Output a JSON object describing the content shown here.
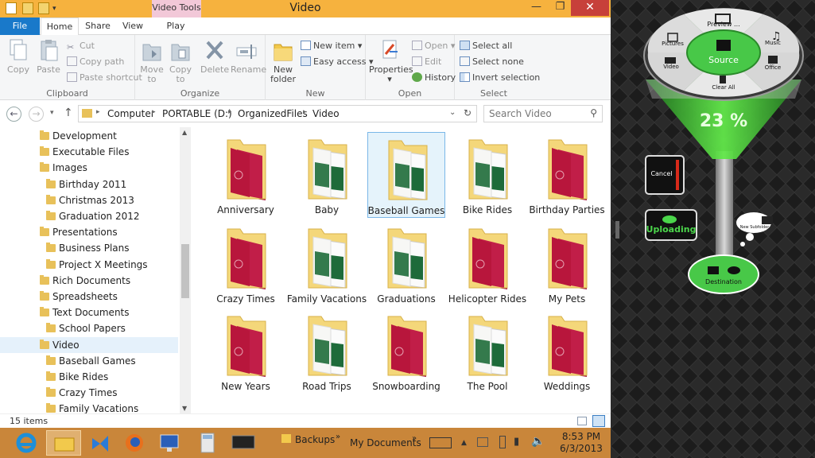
{
  "window": {
    "title": "Video",
    "context_tab": "Video Tools",
    "minimize_icon": "minimize-icon",
    "maximize_icon": "restore-icon",
    "close_icon": "close-icon"
  },
  "tabs": {
    "file": "File",
    "home": "Home",
    "share": "Share",
    "view": "View",
    "play": "Play"
  },
  "ribbon": {
    "clipboard": {
      "label": "Clipboard",
      "copy": "Copy",
      "paste": "Paste",
      "cut": "Cut",
      "copy_path": "Copy path",
      "paste_shortcut": "Paste shortcut"
    },
    "organize": {
      "label": "Organize",
      "move_to": "Move",
      "move_to_sub": "to",
      "copy_to": "Copy",
      "copy_to_sub": "to",
      "delete": "Delete",
      "rename": "Rename"
    },
    "new": {
      "label": "New",
      "new_folder": "New",
      "new_folder_sub": "folder",
      "new_item": "New item",
      "easy_access": "Easy access"
    },
    "open": {
      "label": "Open",
      "properties": "Properties",
      "open": "Open",
      "edit": "Edit",
      "history": "History"
    },
    "select": {
      "label": "Select",
      "select_all": "Select all",
      "select_none": "Select none",
      "invert": "Invert selection"
    }
  },
  "address": {
    "crumbs": [
      "Computer",
      "PORTABLE (D:)",
      "OrganizedFiles",
      "Video"
    ],
    "search_placeholder": "Search Video"
  },
  "nav": [
    {
      "label": "Development",
      "level": 0
    },
    {
      "label": "Executable Files",
      "level": 0
    },
    {
      "label": "Images",
      "level": 0
    },
    {
      "label": "Birthday 2011",
      "level": 1
    },
    {
      "label": "Christmas 2013",
      "level": 1
    },
    {
      "label": "Graduation 2012",
      "level": 1
    },
    {
      "label": "Presentations",
      "level": 0
    },
    {
      "label": "Business Plans",
      "level": 1
    },
    {
      "label": "Project X Meetings",
      "level": 1
    },
    {
      "label": "Rich Documents",
      "level": 0
    },
    {
      "label": "Spreadsheets",
      "level": 0
    },
    {
      "label": "Text Documents",
      "level": 0
    },
    {
      "label": "School Papers",
      "level": 1
    },
    {
      "label": "Video",
      "level": 0,
      "selected": true
    },
    {
      "label": "Baseball Games",
      "level": 1
    },
    {
      "label": "Bike Rides",
      "level": 1
    },
    {
      "label": "Crazy Times",
      "level": 1
    },
    {
      "label": "Family Vacations",
      "level": 1
    }
  ],
  "folders": [
    {
      "label": "Anniversary",
      "theme": "red"
    },
    {
      "label": "Baby",
      "theme": "green"
    },
    {
      "label": "Baseball Games",
      "theme": "green",
      "selected": true
    },
    {
      "label": "Bike Rides",
      "theme": "green"
    },
    {
      "label": "Birthday Parties",
      "theme": "red"
    },
    {
      "label": "Crazy Times",
      "theme": "red"
    },
    {
      "label": "Family Vacations",
      "theme": "green"
    },
    {
      "label": "Graduations",
      "theme": "green"
    },
    {
      "label": "Helicopter Rides",
      "theme": "red"
    },
    {
      "label": "My Pets",
      "theme": "red"
    },
    {
      "label": "New Years",
      "theme": "red"
    },
    {
      "label": "Road Trips",
      "theme": "green"
    },
    {
      "label": "Snowboarding",
      "theme": "red"
    },
    {
      "label": "The Pool",
      "theme": "green"
    },
    {
      "label": "Weddings",
      "theme": "red"
    }
  ],
  "status": {
    "count": "15 items"
  },
  "taskbar": {
    "apps": [
      "internet-explorer-icon",
      "file-explorer-icon",
      "visual-studio-icon",
      "firefox-icon",
      "remote-desktop-icon",
      "calculator-icon",
      "display-icon"
    ],
    "toolbar_backups": "Backups",
    "toolbar_docs": "My Documents",
    "time": "8:53 PM",
    "date": "6/3/2013"
  },
  "funnel": {
    "center": "Source",
    "preview": "Preview ...",
    "pictures": "Pictures",
    "music": "Music",
    "video": "Video",
    "office": "Office",
    "clear_all": "Clear All",
    "percent": "23 %",
    "progress": 0.23,
    "cancel": "Cancel",
    "uploading": "Uploading",
    "new_subfolder": "New Subfolder",
    "destination": "Destination"
  },
  "colors": {
    "accent": "#1979ca",
    "taskbar": "#c9863a",
    "titlebar": "#f6b23e",
    "funnel_green": "#46c83e",
    "red": "#b31b3c",
    "green": "#1e6b3a"
  }
}
